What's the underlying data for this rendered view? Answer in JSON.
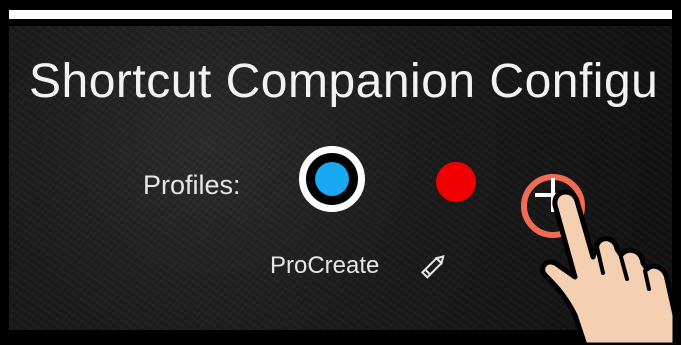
{
  "header": {
    "title": "Shortcut Companion Configu"
  },
  "profiles": {
    "label": "Profiles:",
    "items": [
      {
        "color": "#19a8f2",
        "selected": true
      },
      {
        "color": "#f00000",
        "selected": false
      }
    ],
    "add_icon": "plus-icon",
    "selected_name": "ProCreate",
    "edit_icon": "pencil-icon"
  },
  "colors": {
    "background": "#1b1b1b",
    "text": "#e6e6e6",
    "accent_blue": "#19a8f2",
    "accent_red": "#f00000",
    "add_ring": "#f26b54"
  }
}
